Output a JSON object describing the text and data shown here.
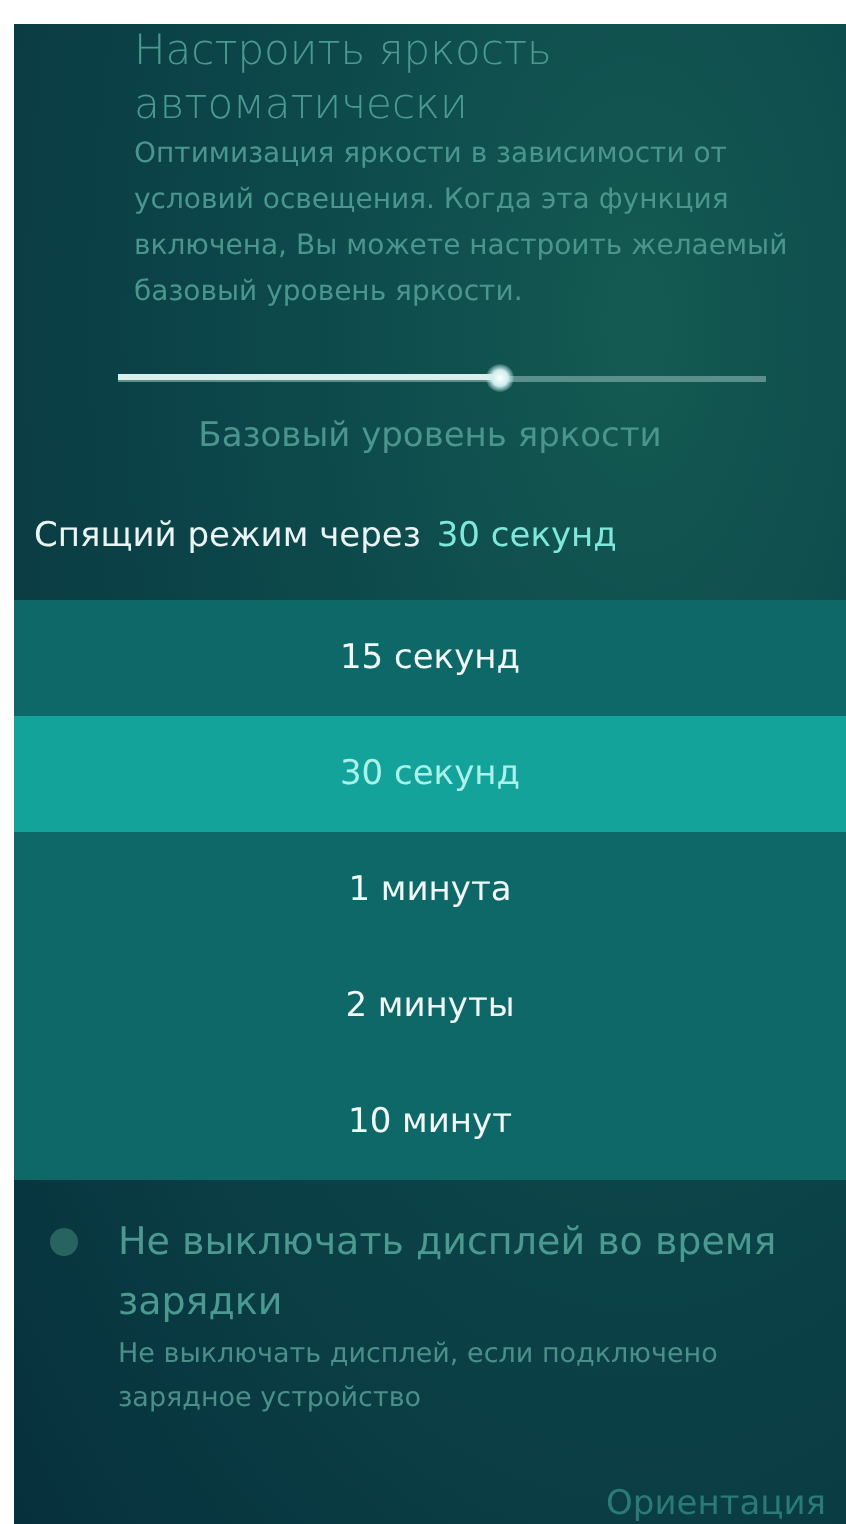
{
  "auto_brightness": {
    "title": "Настроить яркость автоматически",
    "description": "Оптимизация яркости в зависимости от условий освещения. Когда эта функция включена, Вы можете настроить желаемый базовый уровень яркости."
  },
  "brightness_slider": {
    "label": "Базовый уровень яркости",
    "level": 0.59
  },
  "sleep": {
    "label": "Спящий режим через",
    "value": "30 секунд",
    "options": [
      {
        "label": "15 секунд",
        "selected": false
      },
      {
        "label": "30 секунд",
        "selected": true
      },
      {
        "label": "1 минута",
        "selected": false
      },
      {
        "label": "2 минуты",
        "selected": false
      },
      {
        "label": "10 минут",
        "selected": false
      }
    ]
  },
  "keep_display_on": {
    "title": "Не выключать дисплей во время зарядки",
    "description": "Не выключать дисплей, если подключено зарядное устройство",
    "checked": false
  },
  "section_header": "Ориентация"
}
